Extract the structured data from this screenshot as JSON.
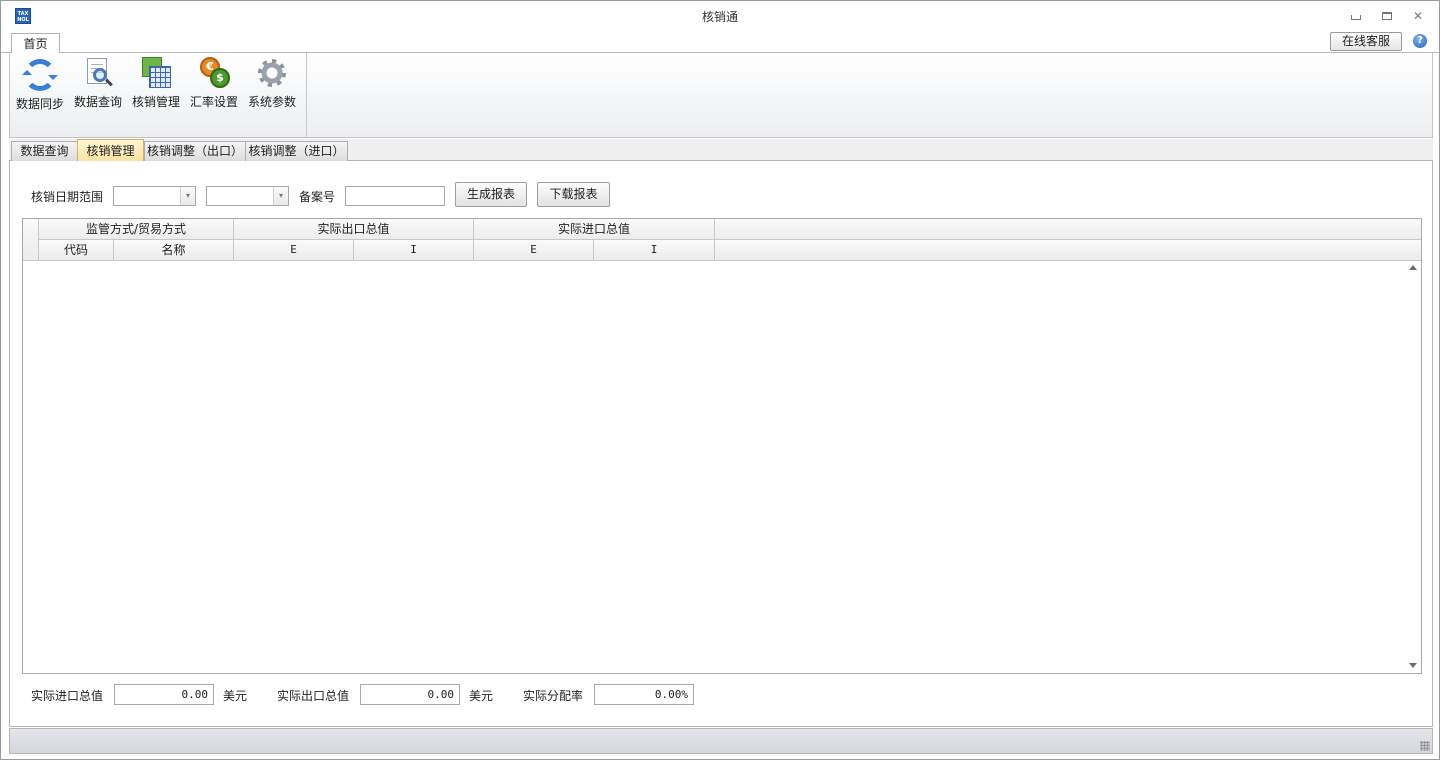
{
  "app": {
    "title": "核销通",
    "icon_text": "TAX NOL",
    "icon_name": "app-logo-icon"
  },
  "window_controls": [
    "minimize",
    "restore",
    "close"
  ],
  "ribbon": {
    "tabs": [
      {
        "label": "首页",
        "selected": true
      }
    ],
    "right": {
      "online_service_label": "在线客服",
      "help_icon": "help-icon",
      "help_glyph": "?"
    },
    "buttons": [
      {
        "label": "数据同步",
        "icon": "sync-icon"
      },
      {
        "label": "数据查询",
        "icon": "search-document-icon"
      },
      {
        "label": "核销管理",
        "icon": "spreadsheet-icon"
      },
      {
        "label": "汇率设置",
        "icon": "currency-coins-icon",
        "glyph_a": "€",
        "glyph_b": "$"
      },
      {
        "label": "系统参数",
        "icon": "gear-icon"
      }
    ]
  },
  "doc_tabs": [
    {
      "label": "数据查询",
      "active": false
    },
    {
      "label": "核销管理",
      "active": true
    },
    {
      "label": "核销调整（出口）",
      "active": false
    },
    {
      "label": "核销调整（进口）",
      "active": false
    }
  ],
  "filters": {
    "date_range_label": "核销日期范围",
    "date_from": {
      "value": "",
      "icon": "dropdown-arrow-icon",
      "glyph": "▾"
    },
    "date_to": {
      "value": "",
      "icon": "dropdown-arrow-icon",
      "glyph": "▾"
    },
    "record_no_label": "备案号",
    "record_no_value": "",
    "generate_button": "生成报表",
    "download_button": "下载报表"
  },
  "grid": {
    "header_groups": [
      "监管方式/贸易方式",
      "实际出口总值",
      "实际进口总值"
    ],
    "sub_headers": [
      "代码",
      "名称",
      "E",
      "I",
      "E",
      "I"
    ],
    "rows": []
  },
  "footer": {
    "import_total_label": "实际进口总值",
    "import_total_value": "0.00",
    "import_unit": "美元",
    "export_total_label": "实际出口总值",
    "export_total_value": "0.00",
    "export_unit": "美元",
    "allocation_rate_label": "实际分配率",
    "allocation_rate_value": "0.00%"
  },
  "colors": {
    "active_tab": "#f8e1a0",
    "accent_blue": "#2a64b8"
  }
}
